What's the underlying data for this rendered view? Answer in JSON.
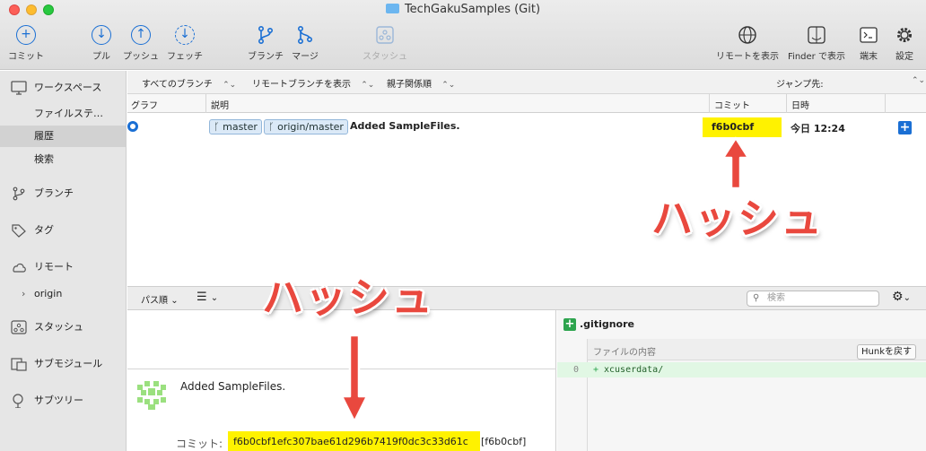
{
  "window": {
    "title": "TechGakuSamples (Git)"
  },
  "toolbar": {
    "commit": "コミット",
    "pull": "プル",
    "push": "プッシュ",
    "fetch": "フェッチ",
    "branch": "ブランチ",
    "merge": "マージ",
    "stash": "スタッシュ",
    "show_remote": "リモートを表示",
    "finder": "Finder で表示",
    "terminal": "端末",
    "settings": "設定"
  },
  "sidebar": {
    "workspace": "ワークスペース",
    "workspace_items": [
      "ファイルステ…",
      "履歴",
      "検索"
    ],
    "selected_item": "履歴",
    "branches": "ブランチ",
    "tags": "タグ",
    "remotes": "リモート",
    "remote_items": [
      "origin"
    ],
    "stashes": "スタッシュ",
    "submodules": "サブモジュール",
    "subtrees": "サブツリー"
  },
  "filter": {
    "branches": "すべてのブランチ",
    "remote_branches": "リモートブランチを表示",
    "order": "親子関係順",
    "jump": "ジャンプ先:"
  },
  "columns": {
    "graph": "グラフ",
    "description": "説明",
    "commit": "コミット",
    "date": "日時"
  },
  "commits": [
    {
      "branch_tags": [
        "master",
        "origin/master"
      ],
      "message": "Added SampleFiles.",
      "hash": "f6b0cbf",
      "date": "今日 12:24"
    }
  ],
  "lower_toolbar": {
    "sort": "パス順",
    "search_placeholder": "検索"
  },
  "details": {
    "message": "Added SampleFiles.",
    "commit_label": "コミット:",
    "full_hash": "f6b0cbf1efc307bae61d296b7419f0dc3c33d61c",
    "short_hash": "[f6b0cbf]"
  },
  "diff": {
    "file": ".gitignore",
    "hunk_header": "ファイルの内容",
    "hunk_button": "Hunkを戻す",
    "lines": [
      {
        "line_no": "0",
        "sign": "+",
        "text": "xcuserdata/"
      }
    ]
  },
  "annotations": {
    "label_top": "ハッシュ",
    "label_bottom": "ハッシュ"
  },
  "colors": {
    "accent": "#1a6fd4",
    "highlight": "#fff200",
    "annotation": "#e9483e",
    "added": "#2da44e"
  }
}
